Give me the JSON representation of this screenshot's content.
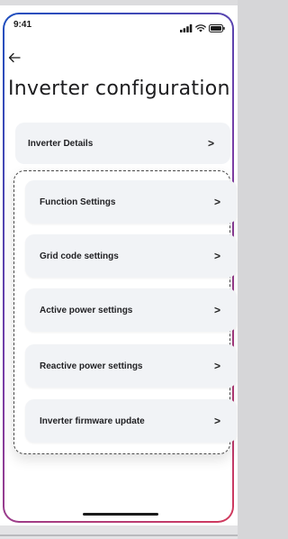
{
  "status_bar": {
    "time": "9:41",
    "icons": [
      "cellular-signal-icon",
      "wifi-icon",
      "battery-icon"
    ]
  },
  "header": {
    "back_icon": "back-arrow-icon",
    "title": "Inverter configuration"
  },
  "menu": {
    "inverter_details": {
      "label": "Inverter Details",
      "chevron": ">"
    },
    "group_items": [
      {
        "label": "Function Settings",
        "chevron": ">"
      },
      {
        "label": "Grid code settings",
        "chevron": ">"
      },
      {
        "label": "Active power settings",
        "chevron": ">"
      },
      {
        "label": "Reactive power settings",
        "chevron": ">"
      },
      {
        "label": "Inverter firmware update",
        "chevron": ">"
      }
    ]
  },
  "colors": {
    "frame_gradient_start": "#1e4fbf",
    "frame_gradient_end": "#d23a5c",
    "row_background": "#f1f3f6",
    "text": "#1f1f22"
  }
}
